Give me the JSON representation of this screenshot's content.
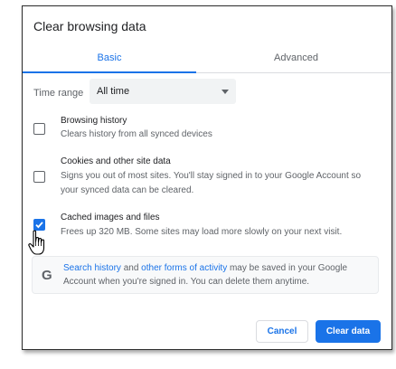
{
  "dialog": {
    "title": "Clear browsing data",
    "tabs": [
      {
        "label": "Basic",
        "active": true
      },
      {
        "label": "Advanced",
        "active": false
      }
    ],
    "time_range": {
      "label": "Time range",
      "selected": "All time"
    },
    "options": [
      {
        "title": "Browsing history",
        "description": "Clears history from all synced devices",
        "checked": false
      },
      {
        "title": "Cookies and other site data",
        "description_line1": "Signs you out of most sites. You'll stay signed in to your Google Account so",
        "description_line2": "your synced data can be cleared.",
        "checked": false
      },
      {
        "title": "Cached images and files",
        "description": "Frees up 320 MB. Some sites may load more slowly on your next visit.",
        "checked": true
      }
    ],
    "info": {
      "link1": "Search history",
      "and": " and ",
      "link2": "other forms of activity",
      "text_rest": " may be saved in your Google Account when you're signed in. You can delete them anytime."
    },
    "buttons": {
      "cancel": "Cancel",
      "clear": "Clear data"
    }
  },
  "colors": {
    "accent": "#1a73e8",
    "text": "#202124",
    "secondary_text": "#5f6368"
  },
  "icons": {
    "info_logo": "G",
    "cursor": "hand-pointer-icon",
    "check": "check-icon",
    "dropdown": "caret-down-icon"
  }
}
